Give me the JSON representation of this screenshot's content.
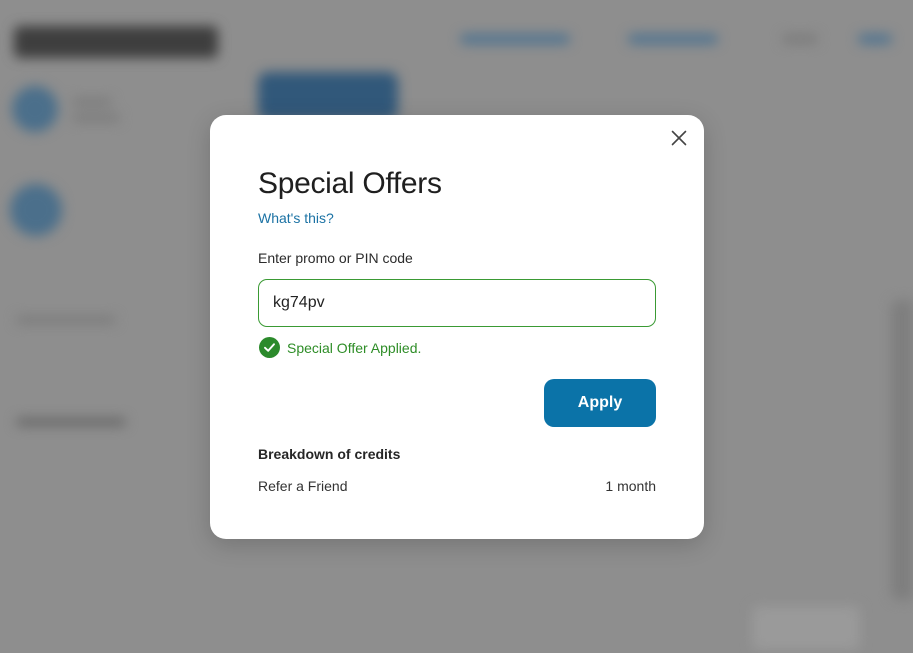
{
  "modal": {
    "title": "Special Offers",
    "help_link": "What's this?",
    "field_label": "Enter promo or PIN code",
    "promo_value": "kg74pv",
    "success_message": "Special Offer Applied.",
    "apply_label": "Apply",
    "breakdown_title": "Breakdown of credits",
    "credits": [
      {
        "label": "Refer a Friend",
        "value": "1 month"
      }
    ]
  },
  "colors": {
    "accent": "#0b73a8",
    "success": "#2e8d27",
    "link": "#1b72a4",
    "overlay": "#8e8e8e"
  },
  "icons": {
    "close": "close-icon",
    "success": "checkmark-circle-icon"
  }
}
